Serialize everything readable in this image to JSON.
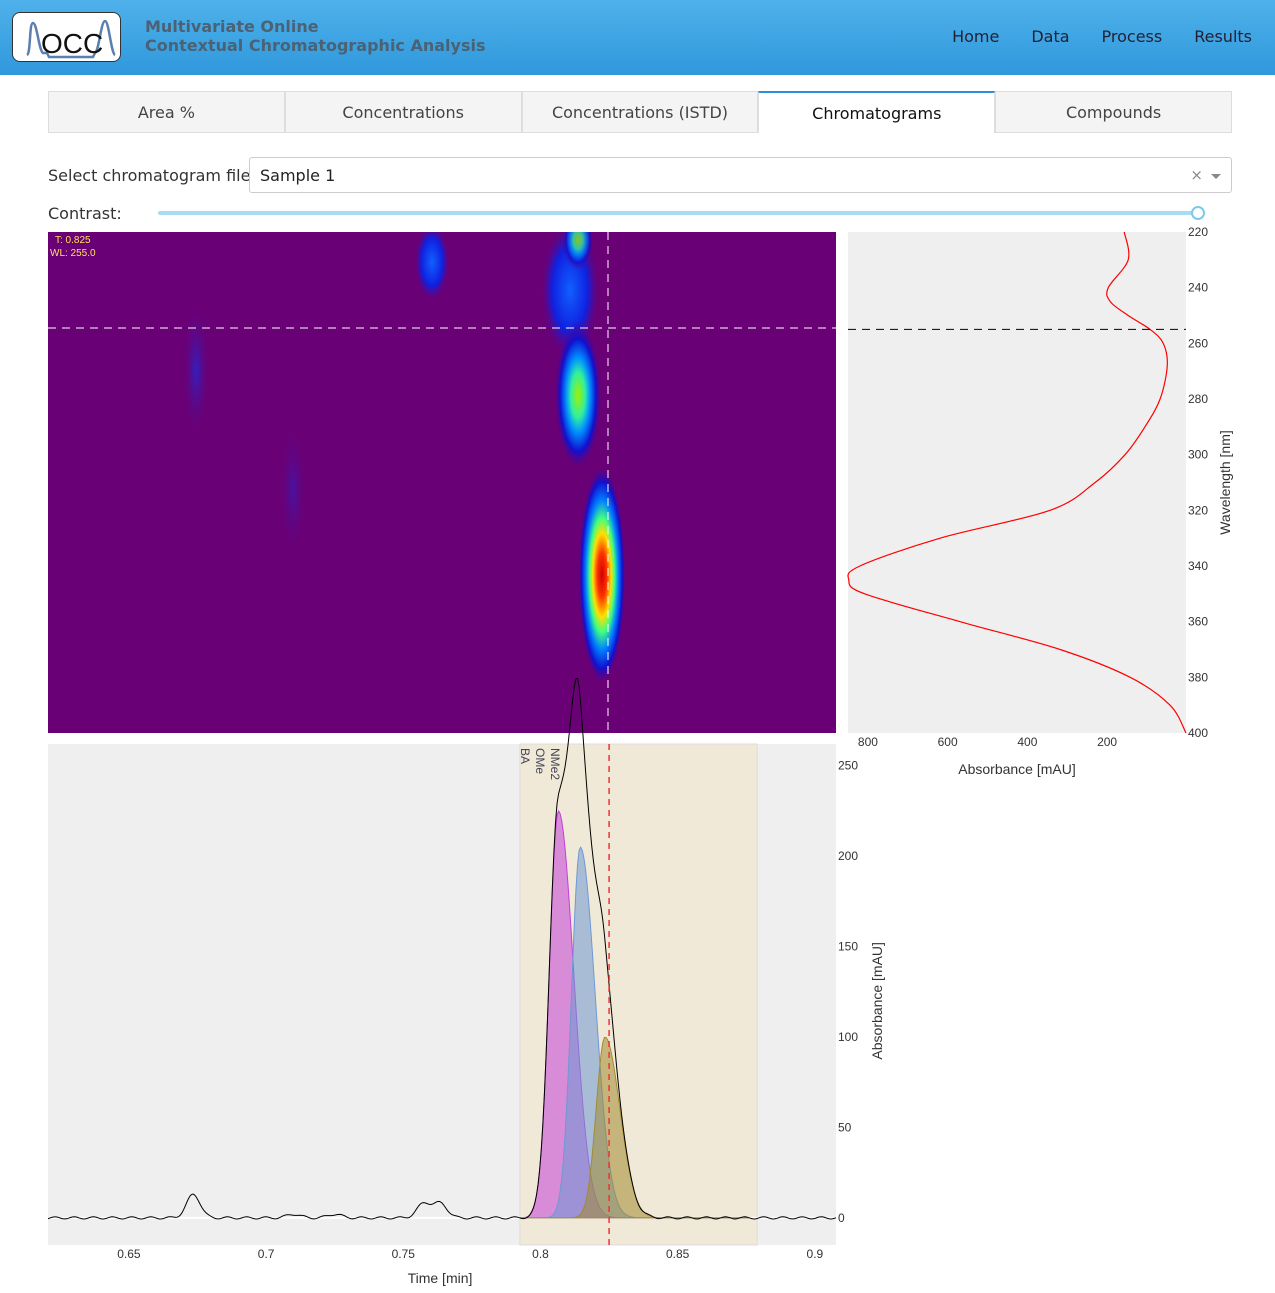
{
  "header": {
    "logo_text": "MOCCA",
    "title_line1": "Multivariate Online",
    "title_line2": "Contextual Chromatographic Analysis",
    "nav": [
      "Home",
      "Data",
      "Process",
      "Results"
    ]
  },
  "tabs": [
    {
      "label": "Area %"
    },
    {
      "label": "Concentrations"
    },
    {
      "label": "Concentrations (ISTD)"
    },
    {
      "label": "Chromatograms",
      "active": true
    },
    {
      "label": "Compounds"
    }
  ],
  "controls": {
    "select_label": "Select chromatogram file",
    "select_value": "Sample 1",
    "clear_icon": "×",
    "contrast_label": "Contrast:",
    "contrast_value": 1.0
  },
  "heatmap": {
    "time_readout": "T: 0.825",
    "wl_readout": "WL: 255.0",
    "cursor_time": 0.825,
    "cursor_wavelength": 255,
    "colorscale": "jet on purple background"
  },
  "chart_data": [
    {
      "type": "line",
      "name": "spectrum",
      "xlabel": "Absorbance [mAU]",
      "ylabel": "Wavelength [nm]",
      "xlim": [
        850,
        2
      ],
      "ylim": [
        220,
        400
      ],
      "xticks": [
        "800",
        "600",
        "400",
        "200"
      ],
      "yticks": [
        "220",
        "240",
        "260",
        "280",
        "300",
        "320",
        "340",
        "360",
        "380",
        "400"
      ],
      "line_color": "#ff0000",
      "cursor_wavelength": 255,
      "points": [
        [
          220,
          157
        ],
        [
          230,
          147
        ],
        [
          240,
          197
        ],
        [
          245,
          192
        ],
        [
          250,
          147
        ],
        [
          255,
          92
        ],
        [
          260,
          59
        ],
        [
          268,
          49
        ],
        [
          280,
          67
        ],
        [
          290,
          105
        ],
        [
          300,
          155
        ],
        [
          310,
          230
        ],
        [
          320,
          343
        ],
        [
          330,
          619
        ],
        [
          340,
          820
        ],
        [
          345,
          848
        ],
        [
          350,
          808
        ],
        [
          360,
          569
        ],
        [
          370,
          318
        ],
        [
          380,
          142
        ],
        [
          390,
          42
        ],
        [
          400,
          2
        ]
      ]
    },
    {
      "type": "area",
      "name": "chromatogram",
      "xlabel": "Time [min]",
      "ylabel": "Absorbance [mAU]",
      "xlim": [
        0.6205,
        0.9077
      ],
      "ylim": [
        -15,
        262
      ],
      "xticks": [
        "0.65",
        "0.7",
        "0.75",
        "0.8",
        "0.85",
        "0.9"
      ],
      "yticks": [
        "0",
        "50",
        "100",
        "150",
        "200",
        "250"
      ],
      "region": [
        0.7925,
        0.879
      ],
      "cursor_time": 0.825,
      "peaks": [
        {
          "name": "BA",
          "apex_time": 0.8065,
          "apex_absorbance": 225,
          "width": 0.0033,
          "color": "#c23fd9"
        },
        {
          "name": "OMe",
          "apex_time": 0.8145,
          "apex_absorbance": 205,
          "width": 0.0032,
          "color": "#6e98d6"
        },
        {
          "name": "NMe2",
          "apex_time": 0.8235,
          "apex_absorbance": 100,
          "width": 0.0032,
          "color": "#a38b2f"
        }
      ],
      "minor_peaks": [
        [
          0.6735,
          13
        ],
        [
          0.7575,
          8
        ],
        [
          0.7635,
          8
        ],
        [
          0.71,
          2
        ],
        [
          0.725,
          2
        ]
      ]
    }
  ]
}
